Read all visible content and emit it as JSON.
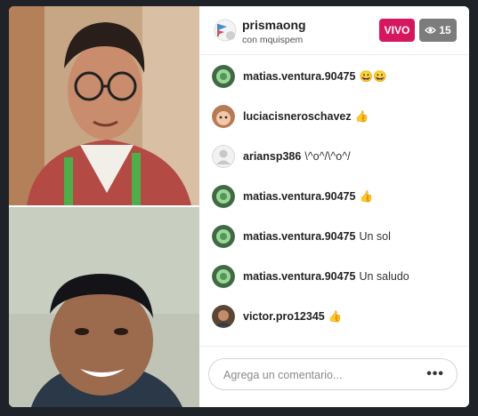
{
  "header": {
    "host_name": "prismaong",
    "host_subtitle": "con mquispem",
    "live_label": "VIVO",
    "viewer_count": "15",
    "viewer_icon": "eye-icon"
  },
  "comments": [
    {
      "user": "matias.ventura.90475",
      "text": "😀😀",
      "avatar": "green-avatar"
    },
    {
      "user": "luciacisneroschavez",
      "text": "👍",
      "avatar": "girl-avatar"
    },
    {
      "user": "ariansp386",
      "text": "\\^o^/\\^o^/",
      "avatar": "default-avatar"
    },
    {
      "user": "matias.ventura.90475",
      "text": "👍",
      "avatar": "green-avatar"
    },
    {
      "user": "matias.ventura.90475",
      "text": "Un sol",
      "avatar": "green-avatar"
    },
    {
      "user": "matias.ventura.90475",
      "text": "Un saludo",
      "avatar": "green-avatar"
    },
    {
      "user": "victor.pro12345",
      "text": "👍",
      "avatar": "man-avatar"
    }
  ],
  "footer": {
    "comment_placeholder": "Agrega un comentario...",
    "more_label": "•••"
  },
  "colors": {
    "live_badge": "#d6175f",
    "viewer_badge": "#7c7c7c",
    "background": "#1f2226"
  }
}
